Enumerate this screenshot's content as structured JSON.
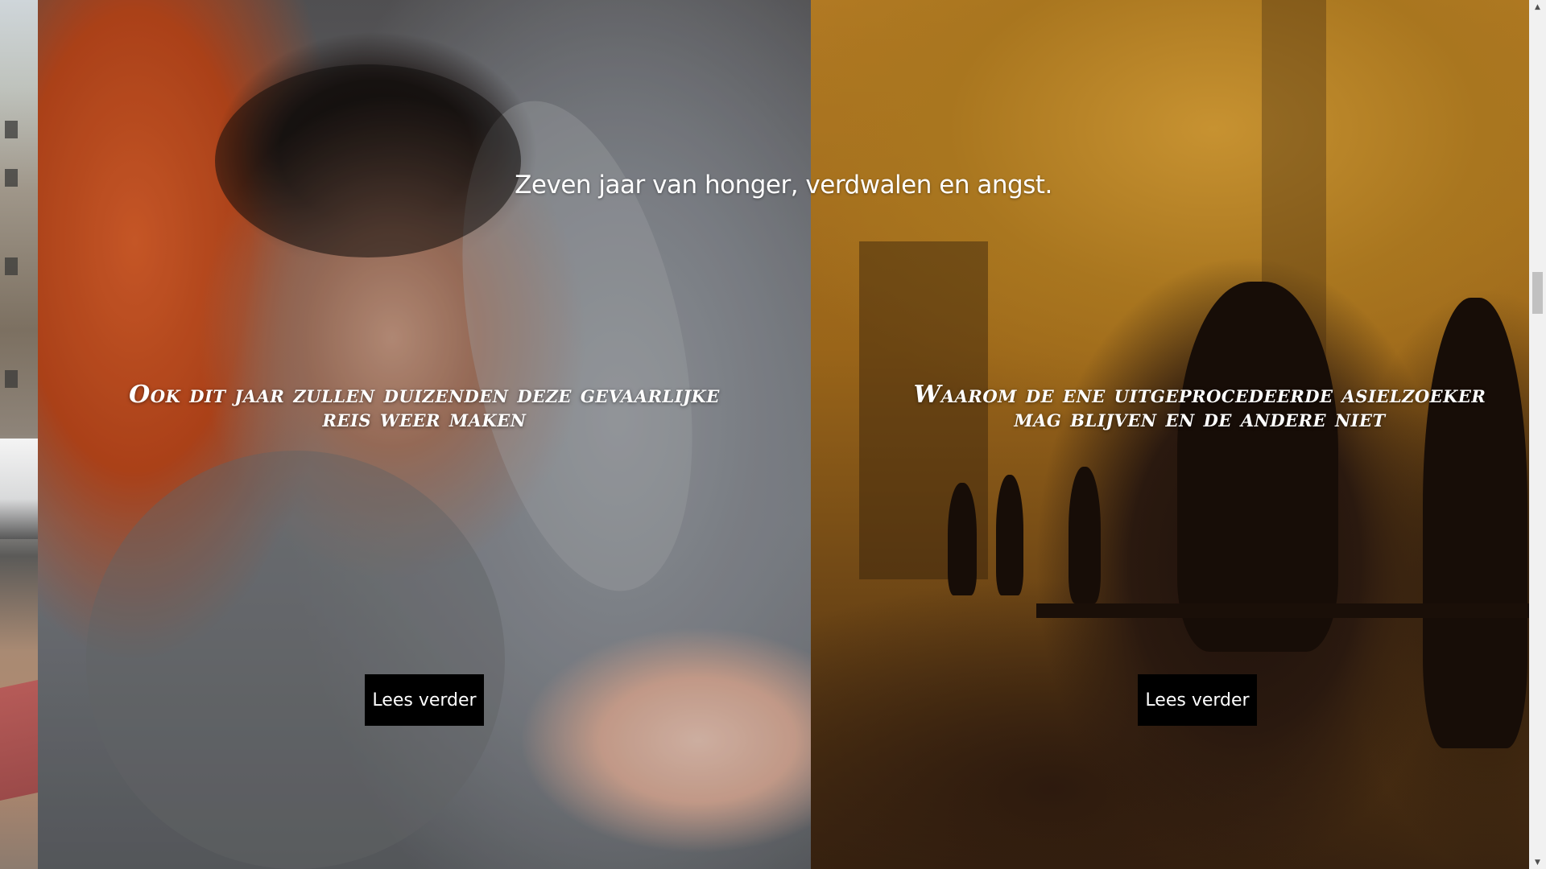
{
  "headline": "Zeven jaar van honger, verdwalen en angst.",
  "cards": [
    {
      "title": "Ook dit jaar zullen duizenden deze gevaarlijke reis weer maken",
      "button_label": "Lees verder",
      "image": "photo-child-wrapped-in-blanket"
    },
    {
      "title": "Waarom de ene uitgeprocedeerde asielzoeker mag blijven en de andere niet",
      "button_label": "Lees verder",
      "image": "illustration-people-waiting-station"
    }
  ],
  "scrollbar": {
    "up_icon": "triangle-up-icon",
    "down_icon": "triangle-down-icon"
  },
  "colors": {
    "button_bg": "#000000",
    "button_text": "#ffffff",
    "overlay_text": "#ffffff"
  }
}
